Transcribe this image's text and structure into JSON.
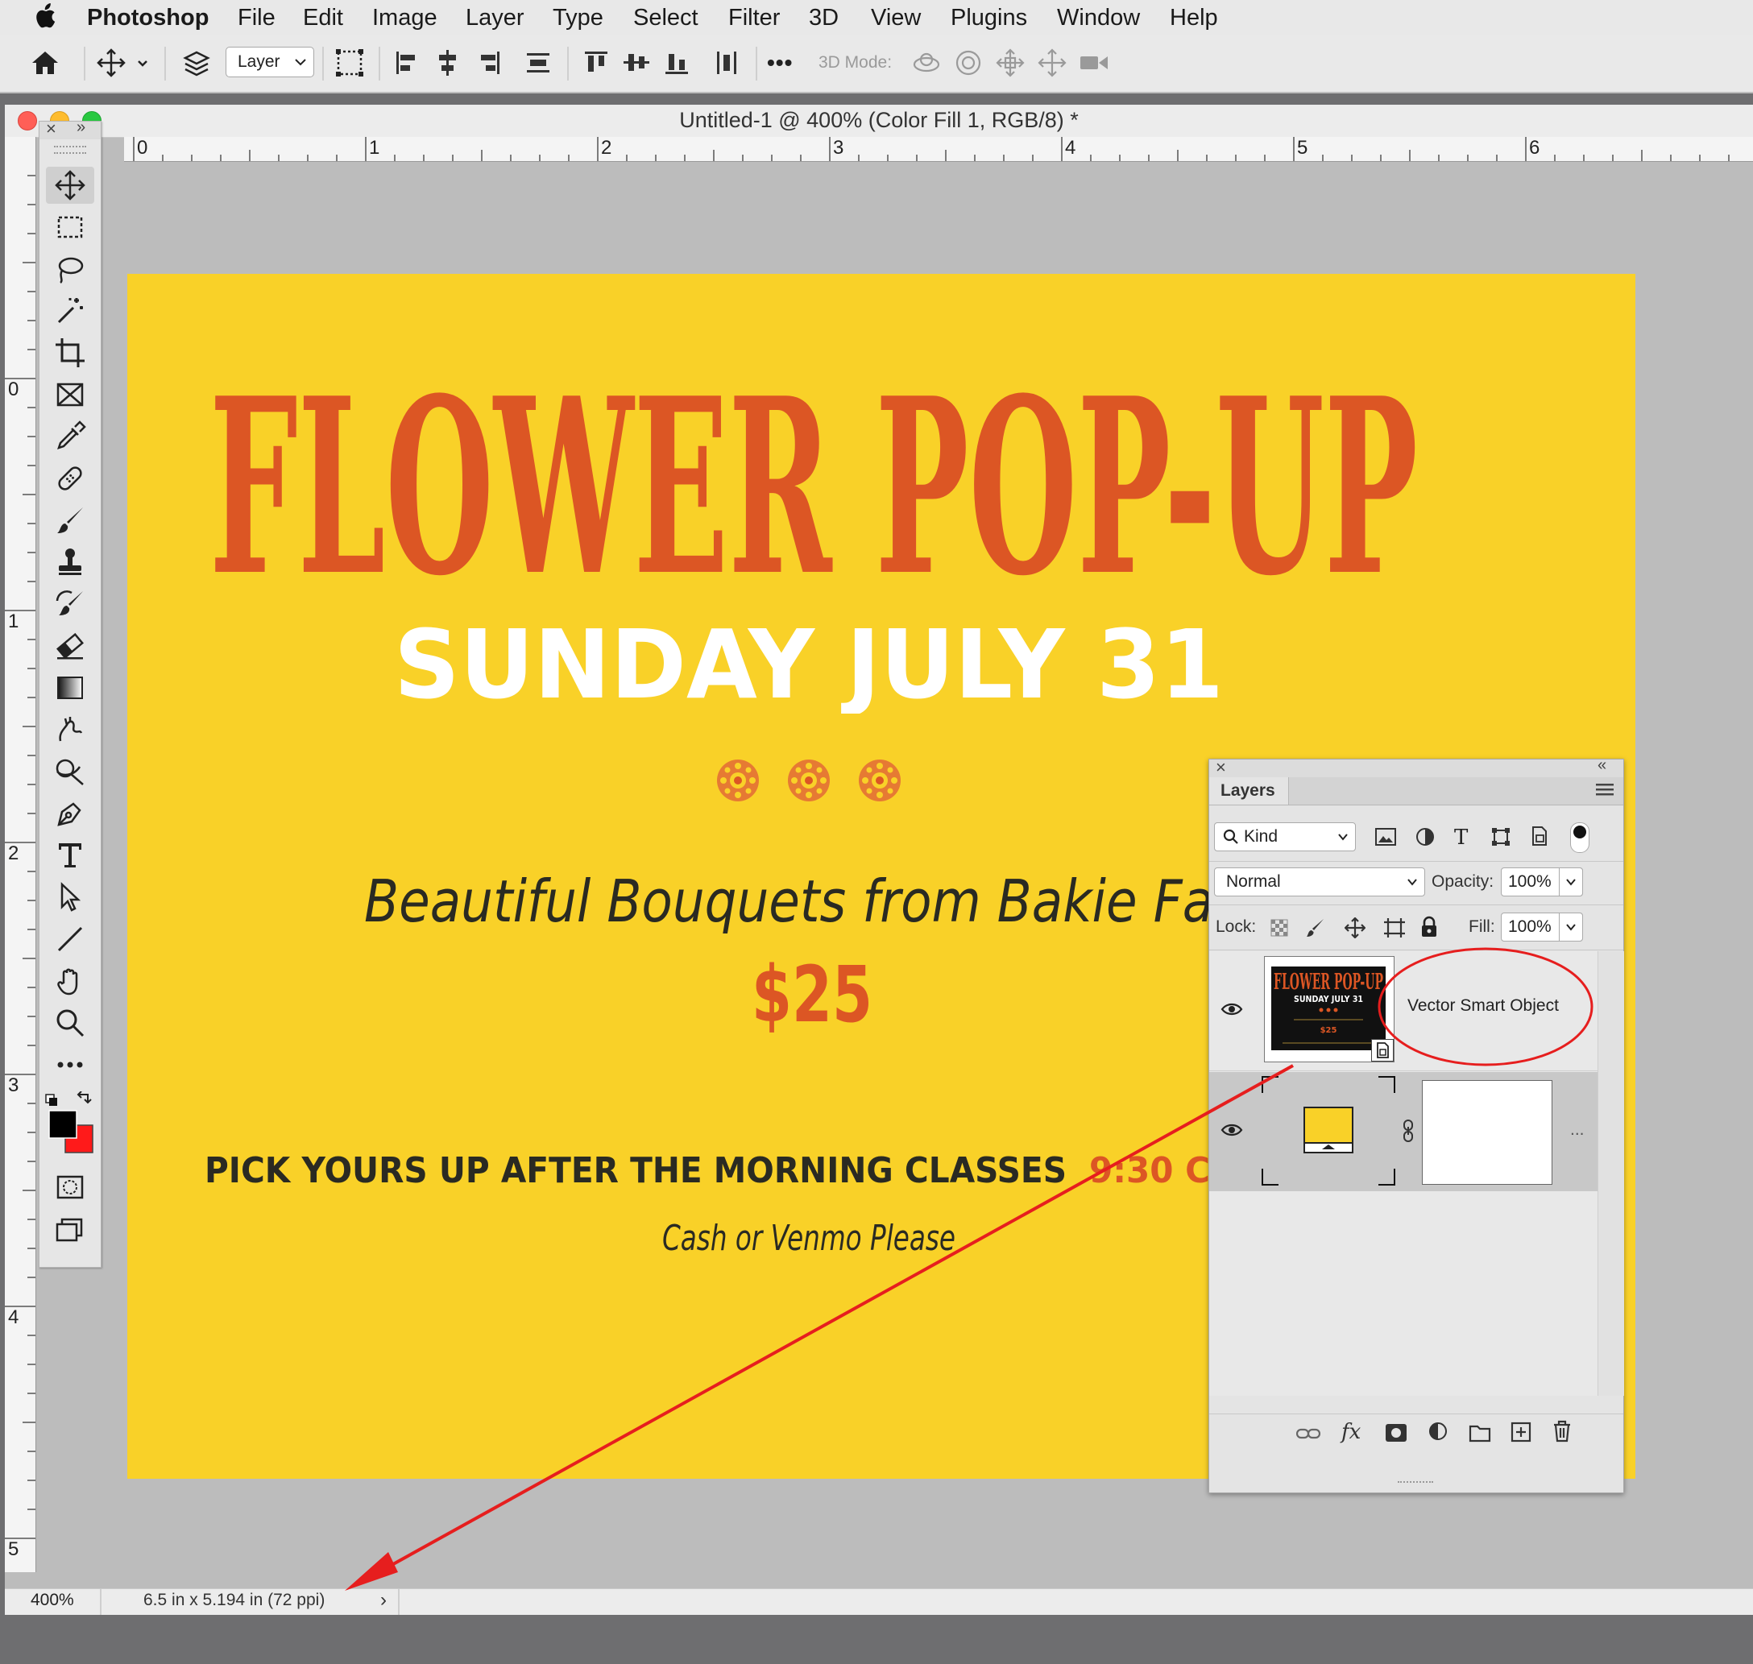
{
  "menubar": {
    "app": "Photoshop",
    "items": [
      "File",
      "Edit",
      "Image",
      "Layer",
      "Type",
      "Select",
      "Filter",
      "3D",
      "View",
      "Plugins",
      "Window",
      "Help"
    ]
  },
  "options": {
    "auto_select": "Layer",
    "more": "•••",
    "mode_label": "3D Mode:"
  },
  "document": {
    "title": "Untitled-1 @ 400% (Color Fill 1, RGB/8) *",
    "h_ruler": [
      "0",
      "1",
      "2",
      "3",
      "4",
      "5",
      "6"
    ],
    "v_ruler": [
      "0",
      "1",
      "2",
      "3",
      "4",
      "5"
    ],
    "zoom": "400%",
    "doc_info": "6.5 in x 5.194 in (72 ppi)"
  },
  "canvas": {
    "headline": "FLOWER POP-UP",
    "date": "SUNDAY JULY 31",
    "tagline": "Beautiful Bouquets from Bakie Far",
    "price": "$25",
    "pickup": "PICK YOURS UP AFTER THE MORNING CLASSES",
    "pickup_time": "9:30 C",
    "payment": "Cash or Venmo Please",
    "bg_color": "#f9d128",
    "headline_color": "#dc5624"
  },
  "layers_panel": {
    "tab": "Layers",
    "filter": "Kind",
    "blend_mode": "Normal",
    "opacity_label": "Opacity:",
    "opacity_value": "100%",
    "lock_label": "Lock:",
    "fill_label": "Fill:",
    "fill_value": "100%",
    "layers": [
      {
        "name": "Vector Smart Object",
        "thumb_title": "FLOWER POP-UP",
        "thumb_sub": "SUNDAY JULY 31",
        "thumb_price": "$25"
      },
      {
        "name": "..."
      }
    ]
  },
  "annotation": {
    "color": "#e61e1e"
  }
}
